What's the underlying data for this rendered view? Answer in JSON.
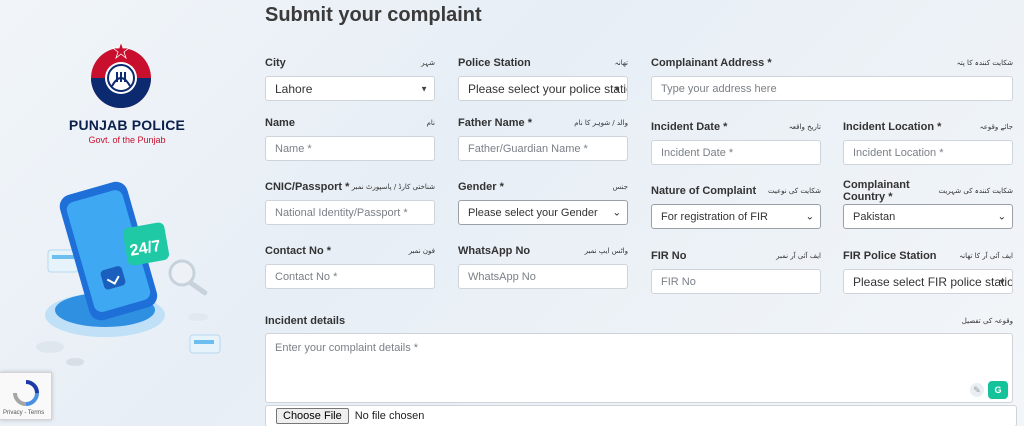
{
  "brand": {
    "title": "PUNJAB POLICE",
    "subtitle": "Govt. of the Punjab"
  },
  "badge": {
    "text": "24/7"
  },
  "recaptcha": {
    "links": "Privacy - Terms"
  },
  "form": {
    "title": "Submit your complaint",
    "city": {
      "label": "City",
      "urdu": "شہر",
      "value": "Lahore"
    },
    "police_station": {
      "label": "Police Station",
      "urdu": "تھانہ",
      "value": "Please select your police station"
    },
    "address": {
      "label": "Complainant Address *",
      "urdu": "شکایت کنندہ کا پتہ",
      "placeholder": "Type your address here"
    },
    "name": {
      "label": "Name",
      "urdu": "نام",
      "placeholder": "Name *"
    },
    "father_name": {
      "label": "Father Name *",
      "urdu": "والد / شوہر کا نام",
      "placeholder": "Father/Guardian Name *"
    },
    "incident_date": {
      "label": "Incident Date *",
      "urdu": "تاریخ واقعہ",
      "placeholder": "Incident Date *"
    },
    "incident_location": {
      "label": "Incident Location *",
      "urdu": "جائے وقوعہ",
      "placeholder": "Incident Location *"
    },
    "cnic": {
      "label": "CNIC/Passport *",
      "urdu": "شناختی کارڈ / پاسپورٹ نمبر",
      "placeholder": "National Identity/Passport *"
    },
    "gender": {
      "label": "Gender *",
      "urdu": "جنس",
      "value": "Please select your Gender"
    },
    "nature": {
      "label": "Nature of Complaint",
      "urdu": "شکایت کی نوعیت",
      "value": "For registration of FIR"
    },
    "country": {
      "label": "Complainant Country *",
      "urdu": "شکایت کنندہ کی شہریت",
      "value": "Pakistan"
    },
    "contact": {
      "label": "Contact No *",
      "urdu": "فون نمبر",
      "placeholder": "Contact No *"
    },
    "whatsapp": {
      "label": "WhatsApp No",
      "urdu": "واٹس ایپ نمبر",
      "placeholder": "WhatsApp No"
    },
    "fir_no": {
      "label": "FIR No",
      "urdu": "ایف آئی آر نمبر",
      "placeholder": "FIR No"
    },
    "fir_station": {
      "label": "FIR Police Station",
      "urdu": "ایف آئی آر کا تھانہ",
      "value": "Please select FIR police station"
    },
    "details": {
      "label": "Incident details",
      "urdu": "وقوعہ کی تفصیل",
      "placeholder": "Enter your complaint details *"
    },
    "file": {
      "button": "Choose File",
      "status": "No file chosen"
    }
  }
}
